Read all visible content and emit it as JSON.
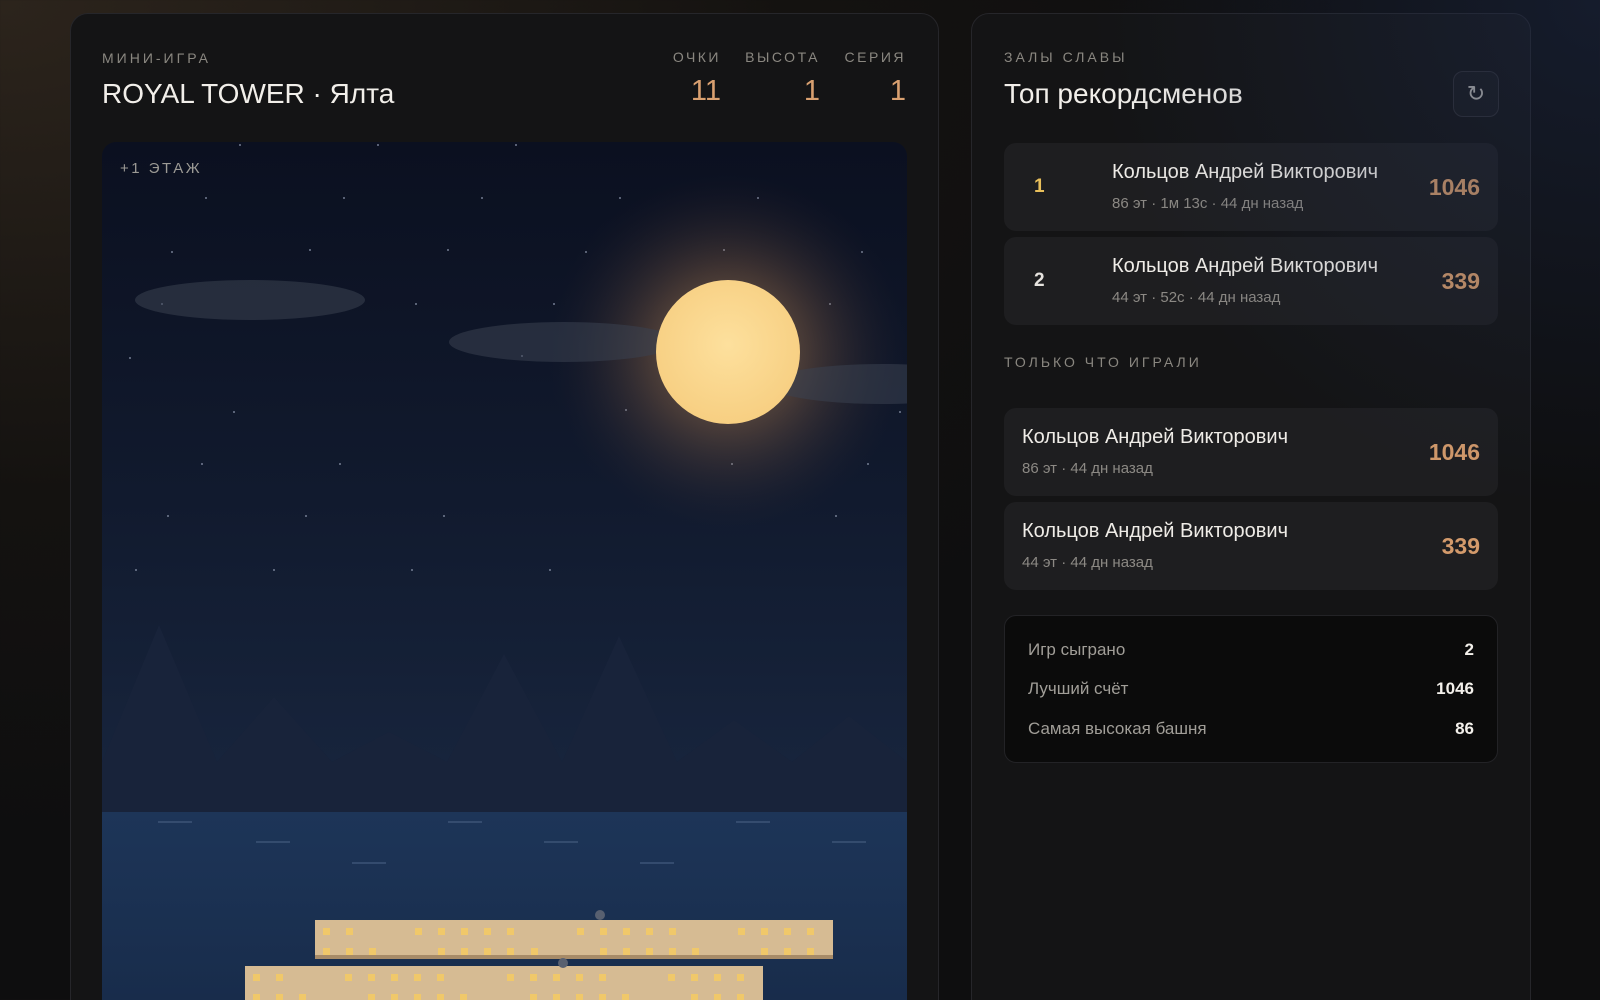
{
  "game": {
    "overline": "МИНИ-ИГРА",
    "title": "ROYAL TOWER · Ялта",
    "stats": [
      {
        "label": "ОЧКИ",
        "value": "11"
      },
      {
        "label": "ВЫСОТА",
        "value": "1"
      },
      {
        "label": "СЕРИЯ",
        "value": "1"
      }
    ],
    "floor_tag": "+1 ЭТАЖ"
  },
  "hall": {
    "overline": "ЗАЛЫ СЛАВЫ",
    "title": "Топ рекордсменов",
    "refresh_icon": "↻",
    "top": [
      {
        "rank": "1",
        "name": "Кольцов Андрей Викторович",
        "meta": "86 эт · 1м 13с · 44 дн назад",
        "score": "1046"
      },
      {
        "rank": "2",
        "name": "Кольцов Андрей Викторович",
        "meta": "44 эт · 52с · 44 дн назад",
        "score": "339"
      }
    ],
    "recent_title": "ТОЛЬКО ЧТО ИГРАЛИ",
    "recent": [
      {
        "name": "Кольцов Андрей Викторович",
        "meta": "86 эт · 44 дн назад",
        "score": "1046"
      },
      {
        "name": "Кольцов Андрей Викторович",
        "meta": "44 эт · 44 дн назад",
        "score": "339"
      }
    ],
    "summary": [
      {
        "label": "Игр сыграно",
        "value": "2"
      },
      {
        "label": "Лучший счёт",
        "value": "1046"
      },
      {
        "label": "Самая высокая башня",
        "value": "86"
      }
    ]
  },
  "colors": {
    "accent": "#d39a6b",
    "gold_rank": "#e8bf5b",
    "moon": "#fcd48f",
    "block": "#d6bb93",
    "window": "#f0c86a"
  }
}
